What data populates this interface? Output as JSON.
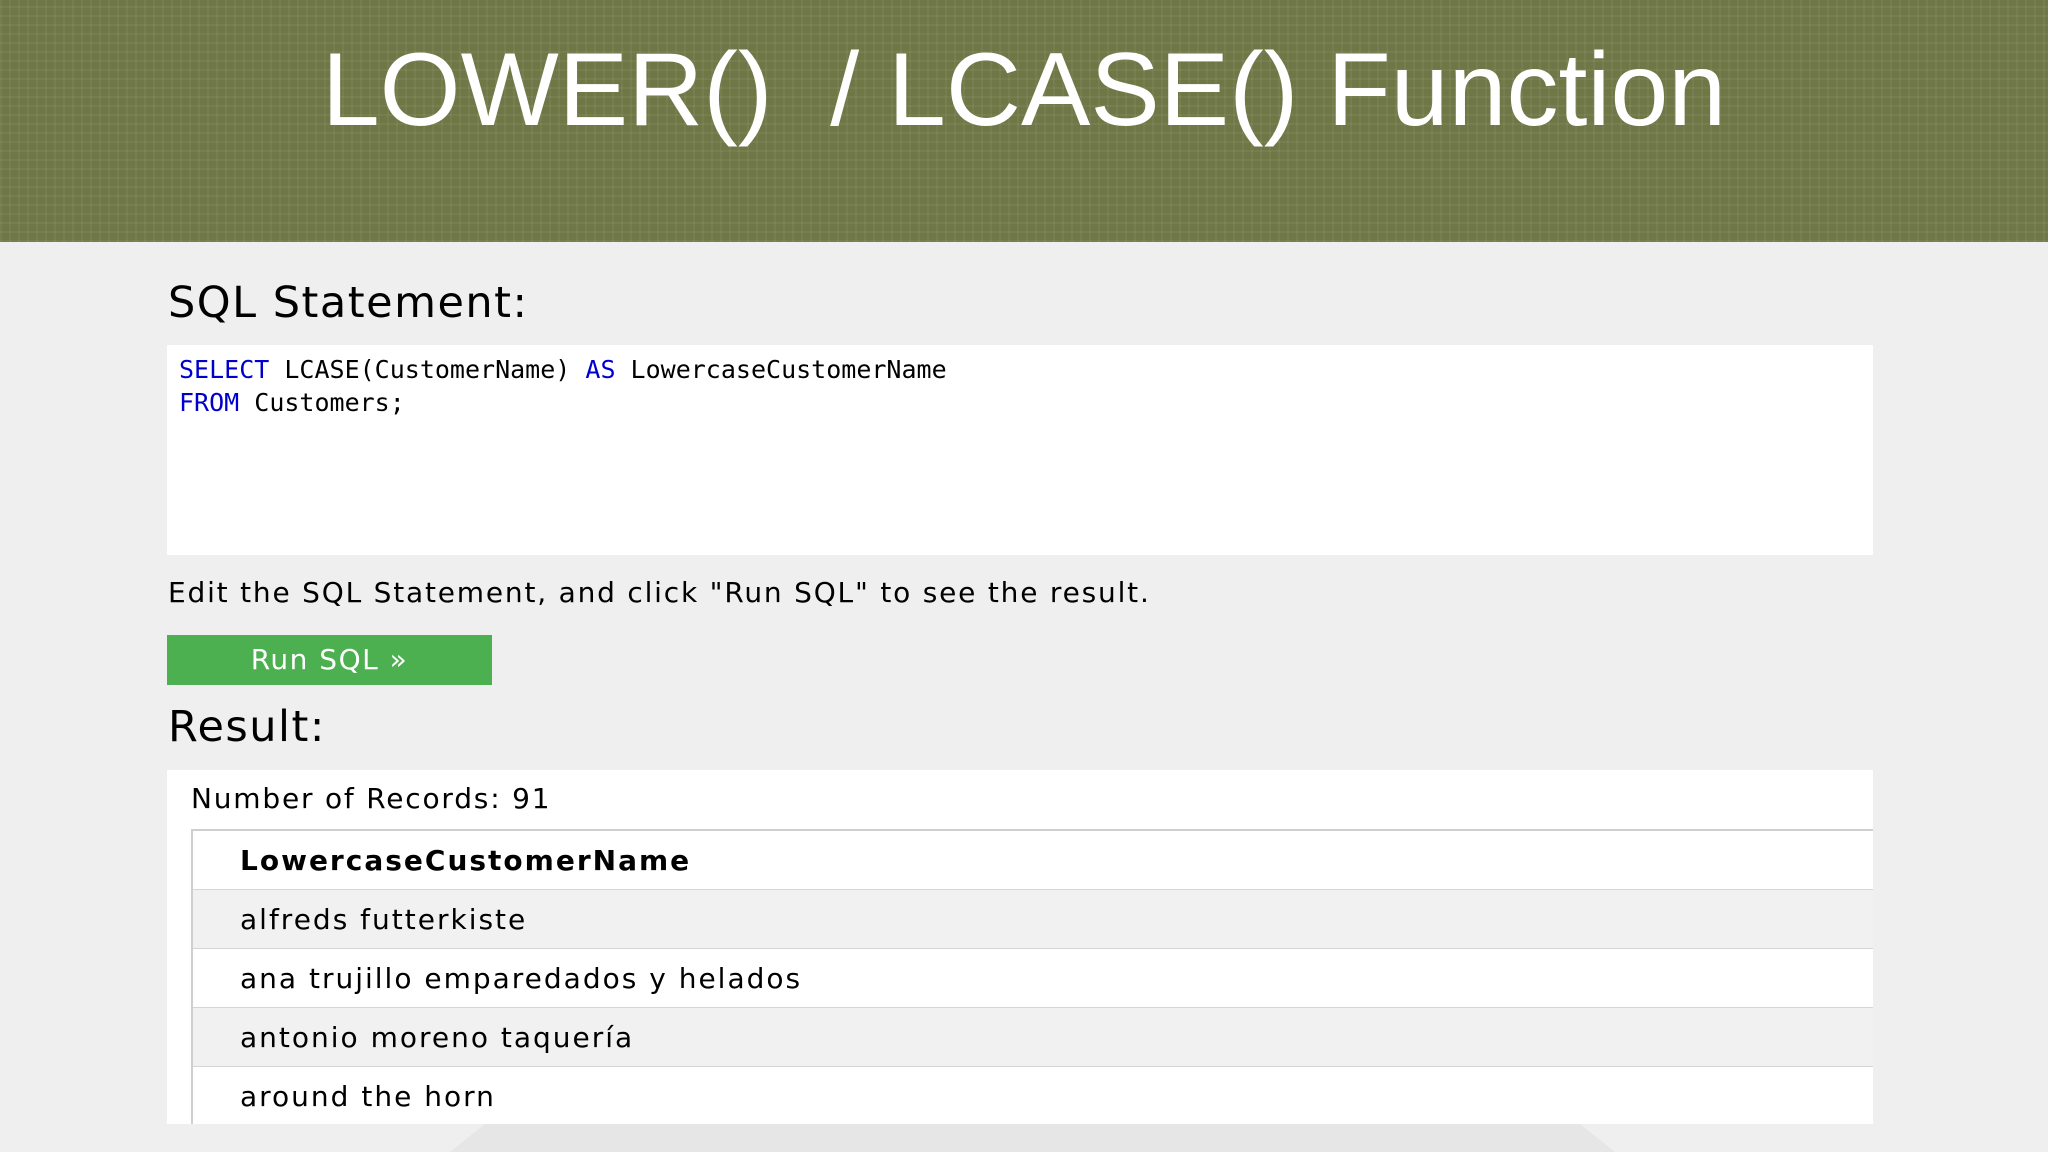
{
  "slide": {
    "title": "LOWER()  / LCASE() Function"
  },
  "editor": {
    "heading": "SQL Statement:",
    "line1_kw1": "SELECT",
    "line1_mid": " LCASE(CustomerName) ",
    "line1_kw2": "AS",
    "line1_end": " LowercaseCustomerName",
    "line2_kw": "FROM",
    "line2_end": " Customers;",
    "hint": "Edit the SQL Statement, and click \"Run SQL\" to see the result.",
    "run_label": "Run SQL »"
  },
  "result": {
    "heading": "Result:",
    "records_label": "Number of Records: 91",
    "column_header": "LowercaseCustomerName",
    "rows": [
      "alfreds futterkiste",
      "ana trujillo emparedados y helados",
      "antonio moreno taquería",
      "around the horn"
    ]
  },
  "colors": {
    "title_band": "#6f7747",
    "run_button": "#4caf50",
    "sql_keyword": "#0000cd",
    "page_background": "#efefef"
  }
}
